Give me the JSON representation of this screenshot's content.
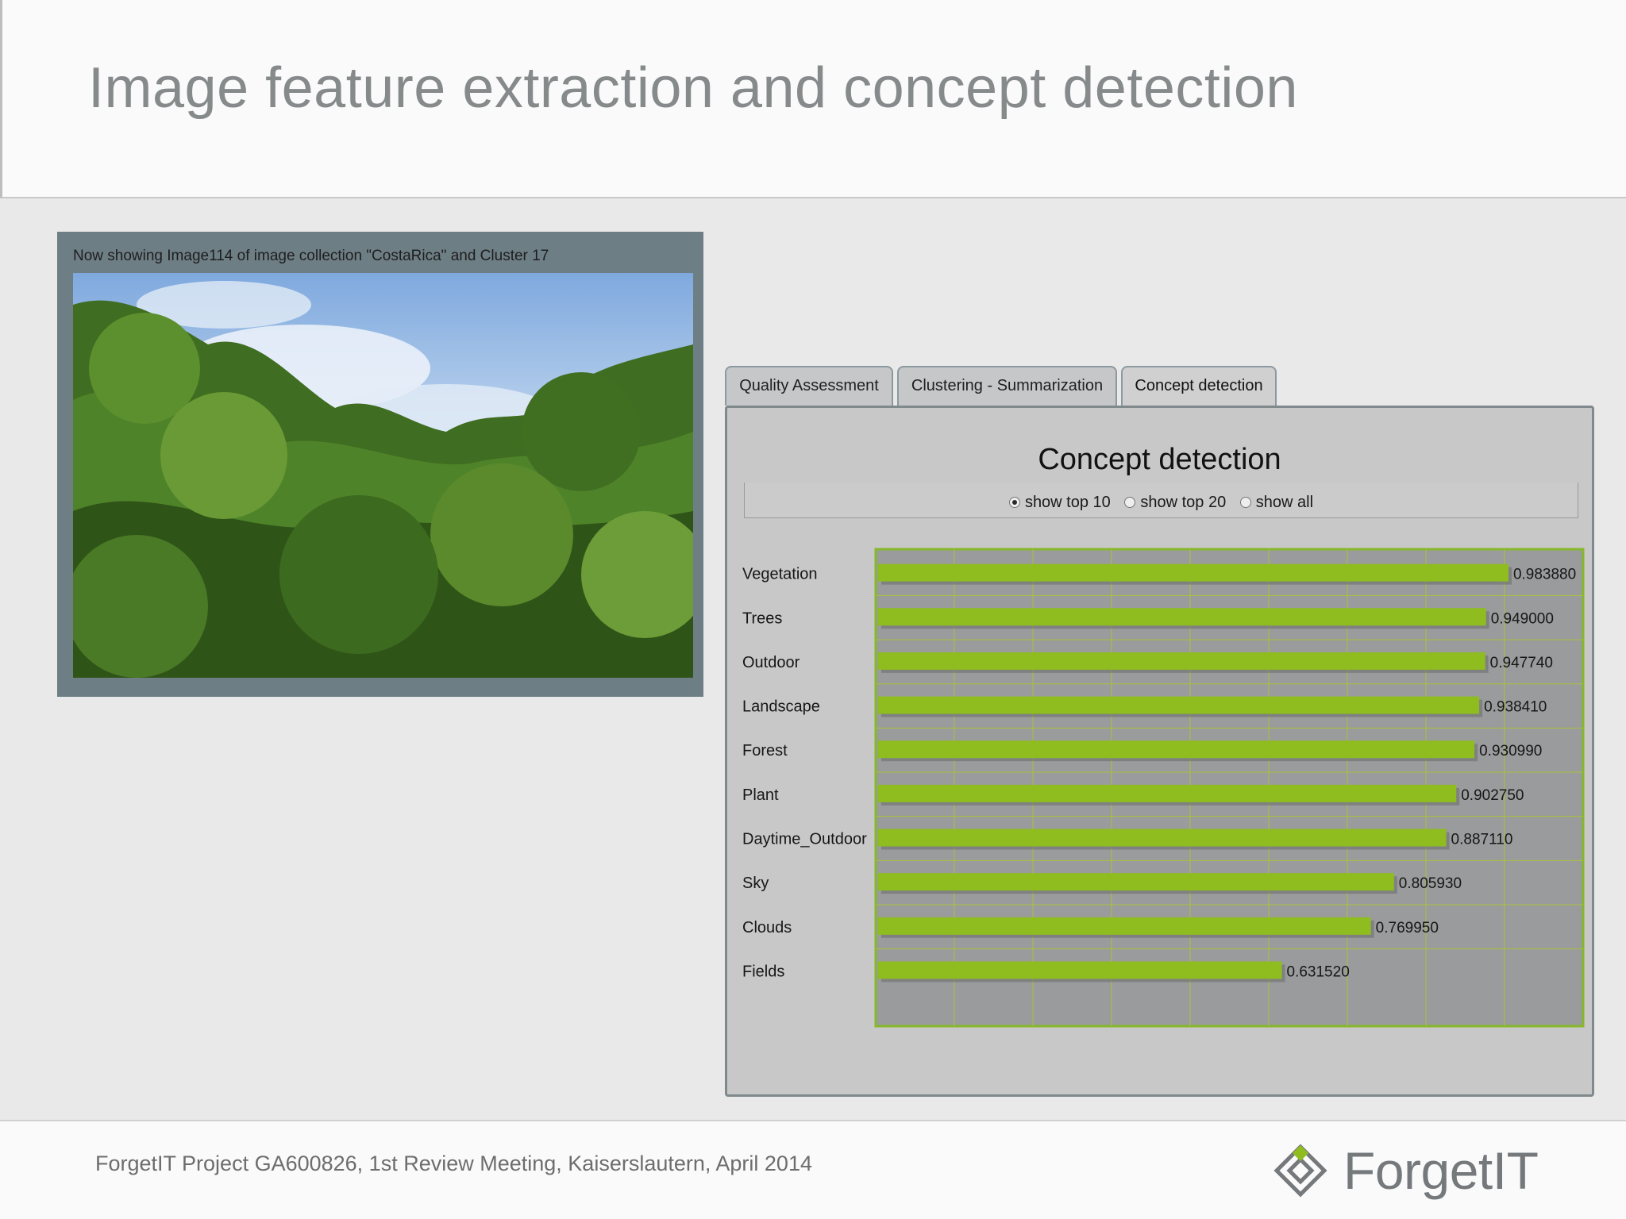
{
  "slide": {
    "title": "Image feature extraction and concept detection",
    "footer": "ForgetIT Project GA600826, 1st Review Meeting, Kaiserslautern, April 2014",
    "logo_text": "ForgetIT"
  },
  "photo_panel": {
    "caption": "Now showing Image114 of image collection \"CostaRica\" and Cluster 17"
  },
  "tabs": [
    {
      "label": "Quality Assessment",
      "active": false
    },
    {
      "label": "Clustering - Summarization",
      "active": false
    },
    {
      "label": "Concept detection",
      "active": true
    }
  ],
  "concept_panel": {
    "title": "Concept detection",
    "options": [
      {
        "label": "show top 10",
        "selected": true
      },
      {
        "label": "show top 20",
        "selected": false
      },
      {
        "label": "show all",
        "selected": false
      }
    ]
  },
  "colors": {
    "bar": "#8fbd1f",
    "chart_border": "#86b82a",
    "chart_bg": "#9a9b9c",
    "grid": "#a9c23a"
  },
  "chart_data": {
    "type": "bar",
    "orientation": "horizontal",
    "categories": [
      "Vegetation",
      "Trees",
      "Outdoor",
      "Landscape",
      "Forest",
      "Plant",
      "Daytime_Outdoor",
      "Sky",
      "Clouds",
      "Fields"
    ],
    "values": [
      0.98388,
      0.949,
      0.94774,
      0.93841,
      0.93099,
      0.90275,
      0.88711,
      0.80593,
      0.76995,
      0.63152
    ],
    "value_labels": [
      "0.983880",
      "0.949000",
      "0.947740",
      "0.938410",
      "0.930990",
      "0.902750",
      "0.887110",
      "0.805930",
      "0.769950",
      "0.631520"
    ],
    "xlim": [
      0,
      1.1
    ],
    "grid": true,
    "title": "",
    "xlabel": "",
    "ylabel": ""
  }
}
